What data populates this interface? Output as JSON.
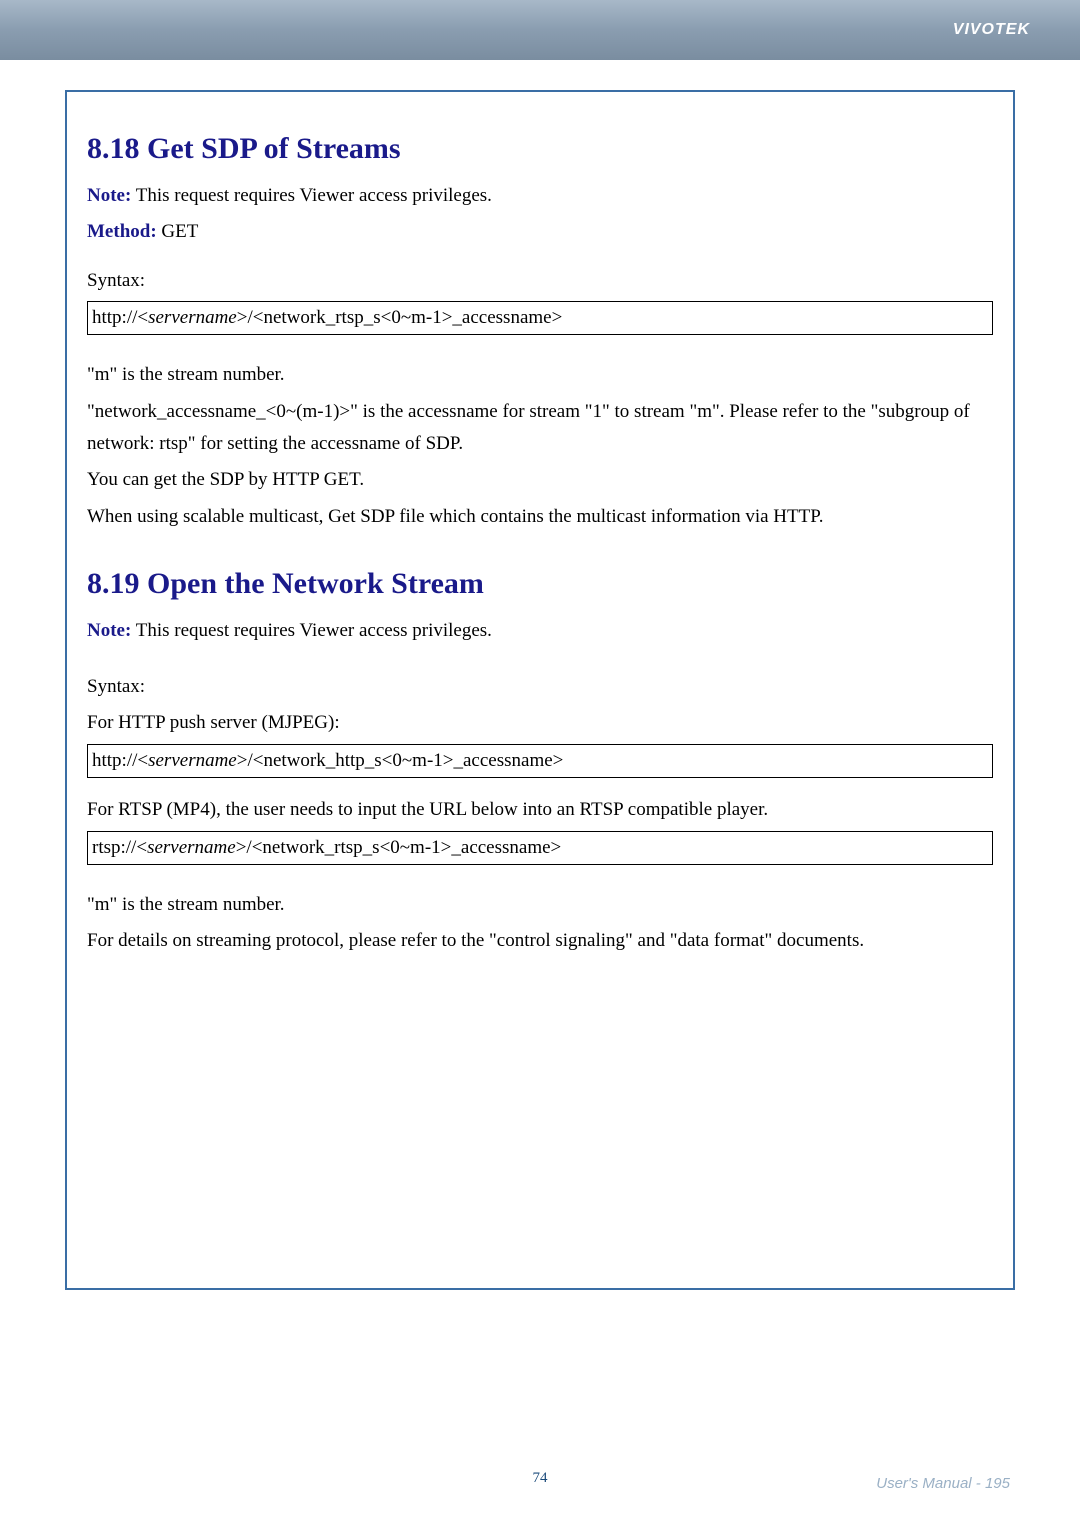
{
  "header": {
    "brand": "VIVOTEK"
  },
  "section1": {
    "heading": "8.18 Get SDP of Streams",
    "note_label": "Note:",
    "note_text": " This request requires Viewer access privileges.",
    "method_label": "Method:",
    "method_text": " GET",
    "syntax_label": "Syntax:",
    "syntax_url": "http://<servername>/<network_rtsp_s<0~m-1>_accessname>",
    "desc1": "\"m\" is the stream number.",
    "desc2": "\"network_accessname_<0~(m-1)>\" is the accessname for stream \"1\" to stream \"m\". Please refer to the \"subgroup of network: rtsp\" for setting the accessname of SDP.",
    "desc3": "You can get the SDP by HTTP GET.",
    "desc4": "When using scalable multicast, Get SDP file which contains the multicast information via HTTP."
  },
  "section2": {
    "heading": "8.19 Open the Network Stream",
    "note_label": "Note:",
    "note_text": " This request requires Viewer access privileges.",
    "syntax_label": "Syntax:",
    "http_desc": "For HTTP push server (MJPEG):",
    "http_url": "http://<servername>/<network_http_s<0~m-1>_accessname>",
    "rtsp_desc": "For RTSP (MP4), the user needs to input the URL below into an RTSP compatible player.",
    "rtsp_url": "rtsp://<servername>/<network_rtsp_s<0~m-1>_accessname>",
    "desc1": "\"m\" is the stream number.",
    "desc2": "For details on streaming protocol, please refer to the \"control signaling\" and \"data format\" documents."
  },
  "footer": {
    "page_number": "74",
    "manual_text": "User's Manual - 195"
  }
}
